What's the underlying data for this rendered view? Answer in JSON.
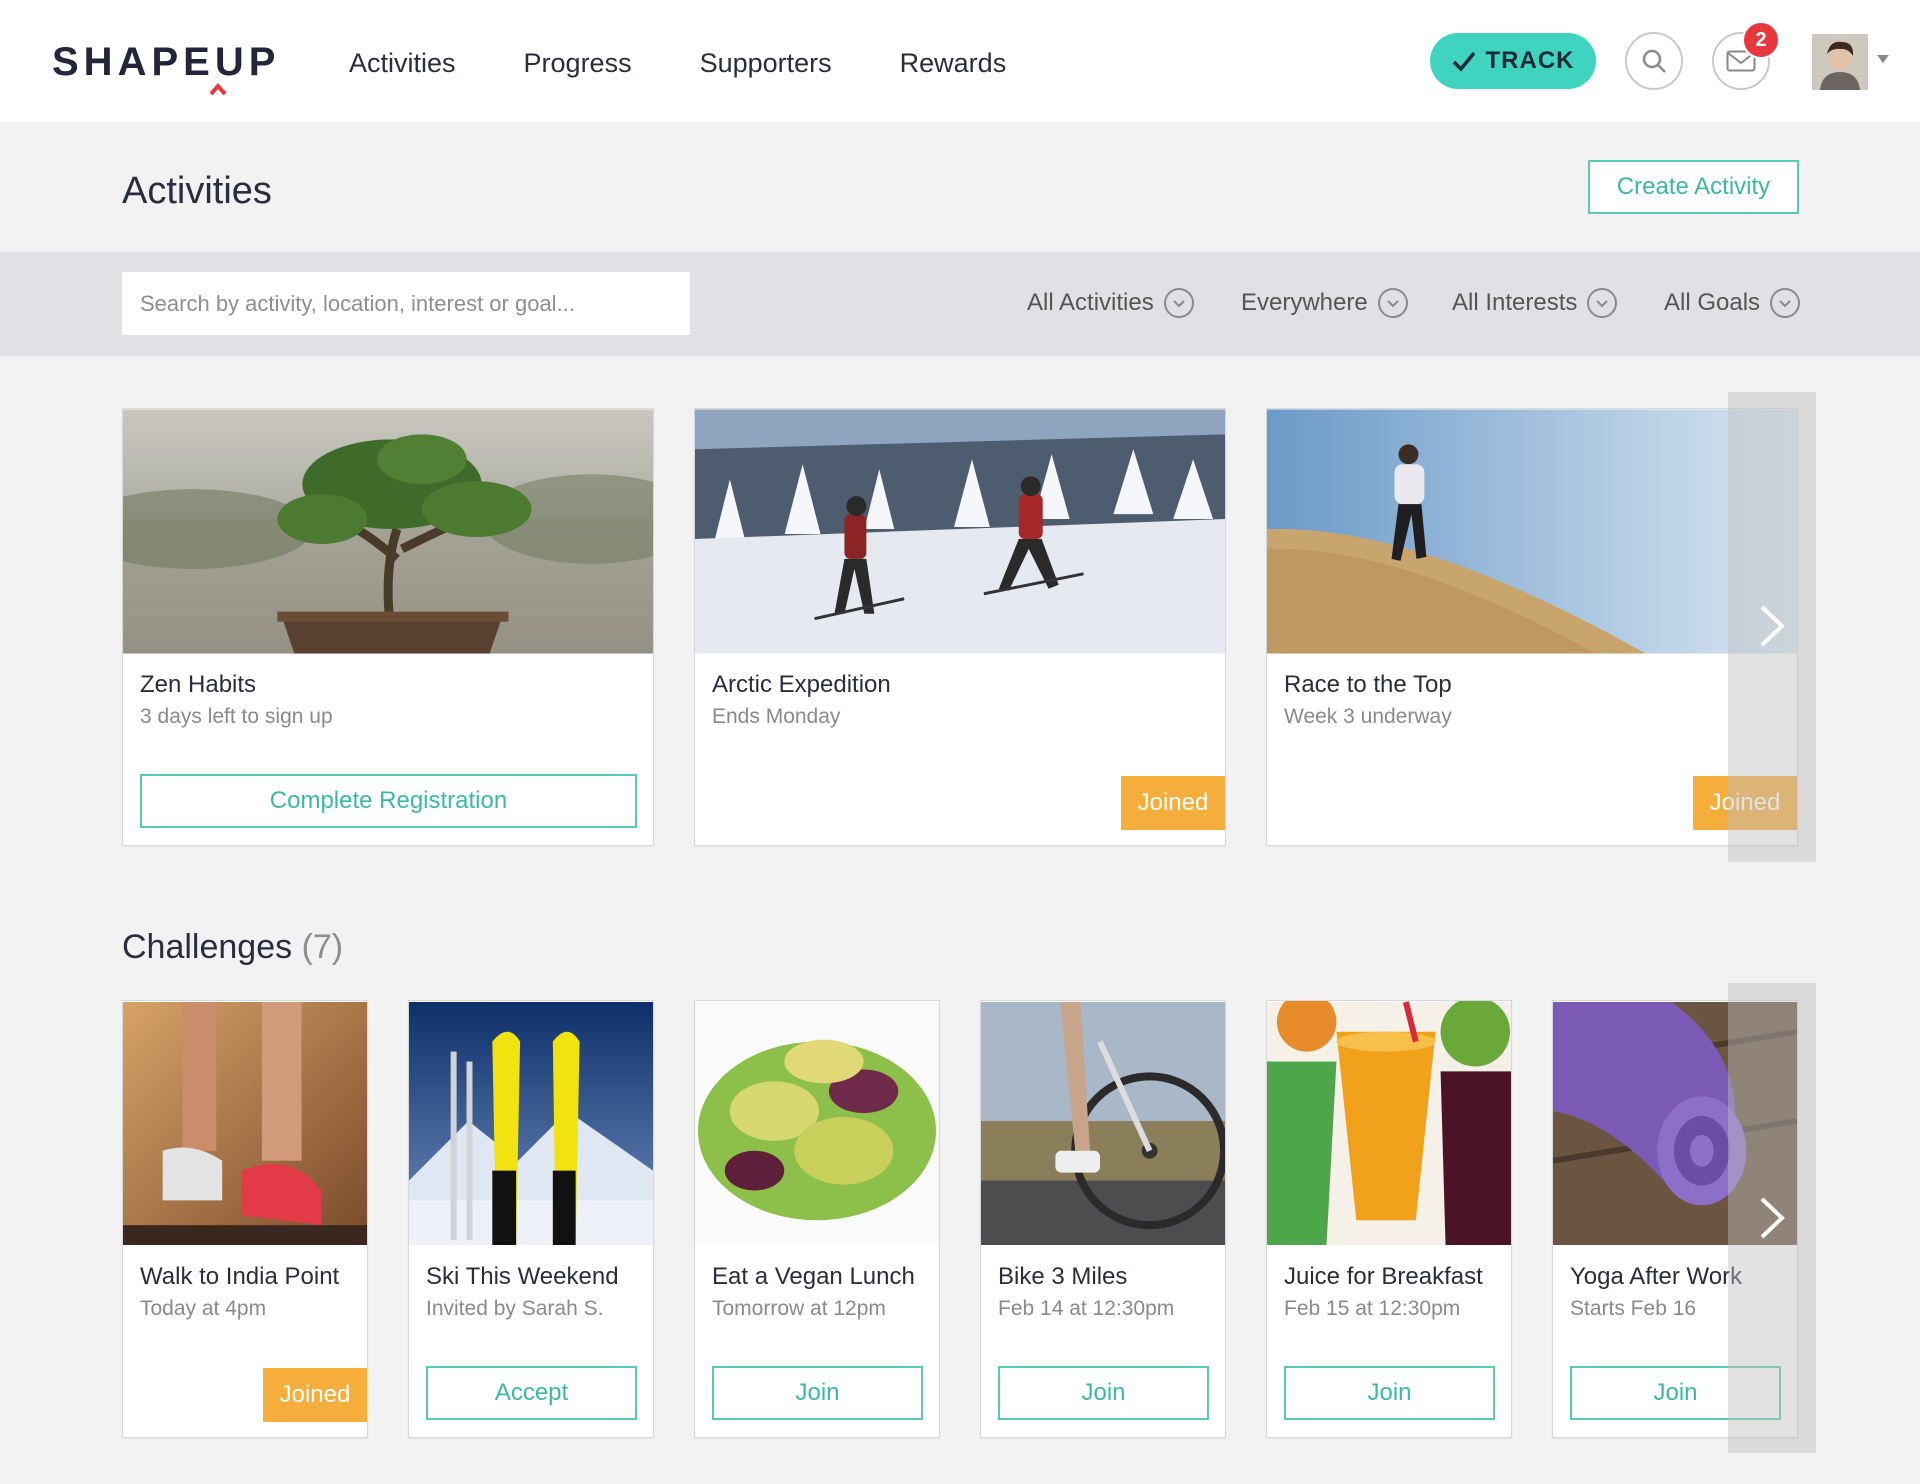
{
  "brand": {
    "name_part1": "SHAPE",
    "name_part2": "UP",
    "accent": "#e8383d"
  },
  "nav": {
    "items": [
      "Activities",
      "Progress",
      "Supporters",
      "Rewards"
    ]
  },
  "header": {
    "track_label": "TRACK",
    "track_color": "#3fd4bf",
    "notification_count": "2",
    "icons": [
      "check-icon",
      "search-icon",
      "mail-icon",
      "user-avatar",
      "caret-down-icon"
    ]
  },
  "page": {
    "title": "Activities",
    "create_label": "Create Activity"
  },
  "search": {
    "placeholder": "Search by activity, location, interest or goal..."
  },
  "filters": [
    "All Activities",
    "Everywhere",
    "All Interests",
    "All Goals"
  ],
  "activities": [
    {
      "title": "Zen Habits",
      "subtitle": "3 days left to sign up",
      "action": "Complete Registration"
    },
    {
      "title": "Arctic Expedition",
      "subtitle": "Ends Monday",
      "status": "Joined"
    },
    {
      "title": "Race to the Top",
      "subtitle": "Week 3 underway",
      "status": "Joined"
    }
  ],
  "challenges": {
    "title": "Challenges",
    "count": "(7)",
    "items": [
      {
        "title": "Walk to India Point",
        "subtitle": "Today at 4pm",
        "status": "Joined"
      },
      {
        "title": "Ski This Weekend",
        "subtitle": "Invited by Sarah S.",
        "action": "Accept"
      },
      {
        "title": "Eat a Vegan Lunch",
        "subtitle": "Tomorrow at 12pm",
        "action": "Join"
      },
      {
        "title": "Bike 3 Miles",
        "subtitle": "Feb 14 at 12:30pm",
        "action": "Join"
      },
      {
        "title": "Juice for Breakfast",
        "subtitle": "Feb 15 at 12:30pm",
        "action": "Join"
      },
      {
        "title": "Yoga After Work",
        "subtitle": "Starts Feb 16",
        "action": "Join"
      }
    ]
  },
  "colors": {
    "teal": "#56cbb6",
    "joined": "#f5ae3b",
    "text": "#2a2d3e"
  }
}
